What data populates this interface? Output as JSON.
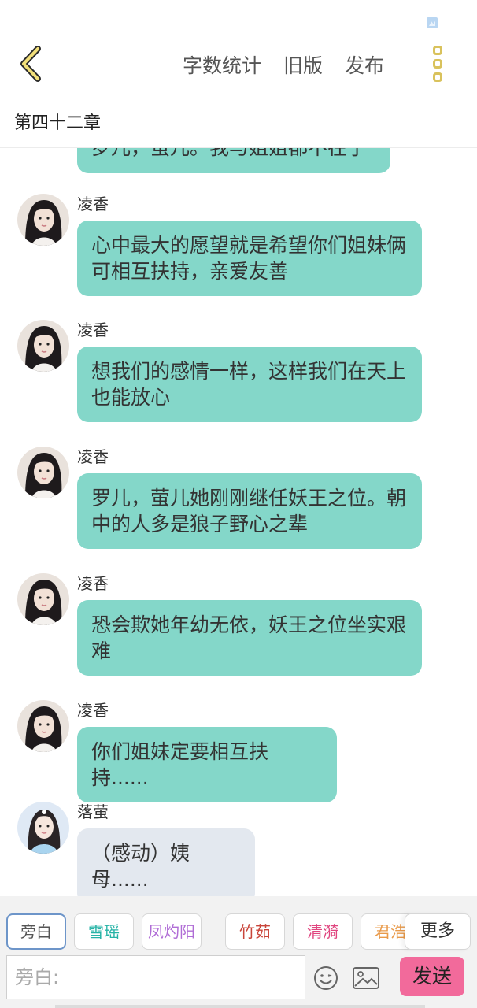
{
  "header": {
    "actions": [
      "字数统计",
      "旧版",
      "发布"
    ],
    "chapter_title": "第四十二章"
  },
  "messages": {
    "partial_text": "罗儿，萤儿。我与姐姐都不在了",
    "items": [
      {
        "sender": "凌香",
        "text": "心中最大的愿望就是希望你们姐妹俩可相互扶持，亲爱友善"
      },
      {
        "sender": "凌香",
        "text": "想我们的感情一样，这样我们在天上也能放心"
      },
      {
        "sender": "凌香",
        "text": "罗儿，萤儿她刚刚继任妖王之位。朝中的人多是狼子野心之辈"
      },
      {
        "sender": "凌香",
        "text": "恐会欺她年幼无依，妖王之位坐实艰难"
      },
      {
        "sender": "凌香",
        "text": "你们姐妹定要相互扶持......"
      },
      {
        "sender": "落萤",
        "text": "（感动）姨母......"
      }
    ]
  },
  "composer": {
    "characters": [
      {
        "label": "旁白",
        "color": "#555555"
      },
      {
        "label": "雪瑶",
        "color": "#26b3a6"
      },
      {
        "label": "凤灼阳",
        "color": "#b06dd6"
      },
      {
        "label": "竹茹",
        "color": "#c9453a"
      },
      {
        "label": "清漪",
        "color": "#e0457f"
      },
      {
        "label": "君浩",
        "color": "#e99a4a"
      }
    ],
    "more_label": "更多",
    "input_placeholder": "旁白:",
    "send_label": "发送"
  },
  "colors": {
    "bubble_teal": "#84d7c9",
    "bubble_gray": "#e3e8ef",
    "send_pink": "#f26a9b",
    "accent_yellow": "#d9c25c"
  }
}
